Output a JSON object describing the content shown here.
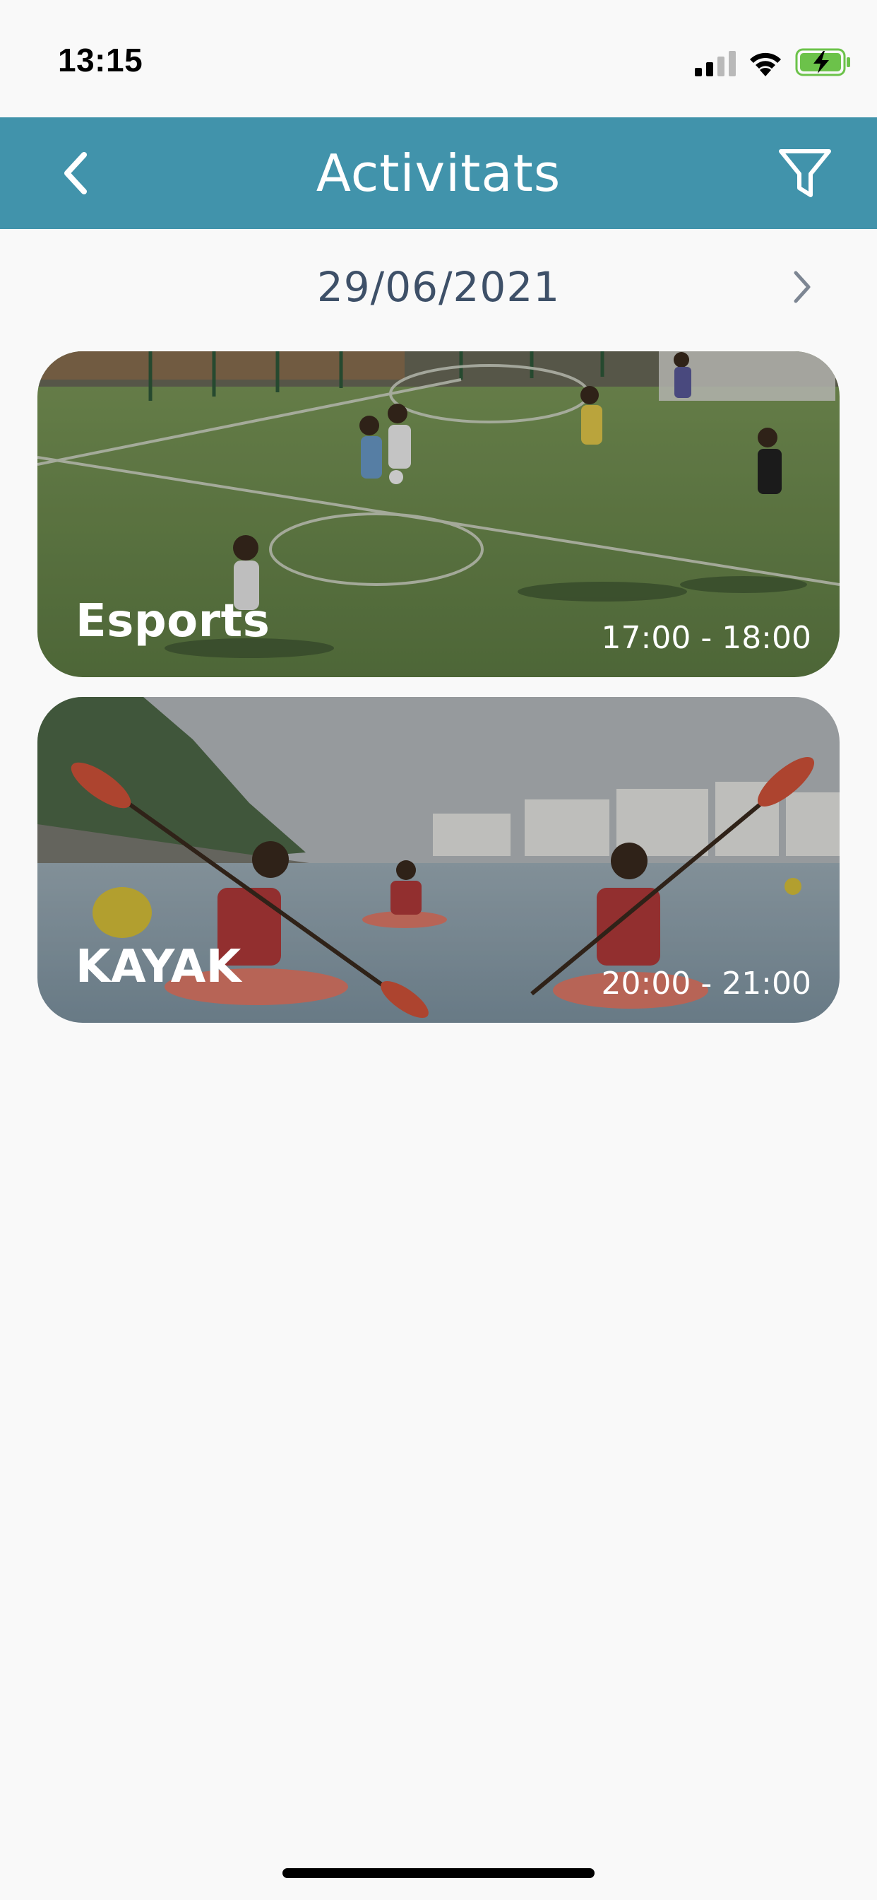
{
  "status_bar": {
    "time": "13:15",
    "icons": [
      "signal-icon",
      "wifi-icon",
      "battery-charging-icon"
    ],
    "battery_color": "#6cc24a"
  },
  "header": {
    "title": "Activitats",
    "back_icon": "chevron-left-icon",
    "filter_icon": "filter-icon",
    "background": "#4193ab"
  },
  "date_nav": {
    "date": "29/06/2021",
    "next_icon": "chevron-right-icon"
  },
  "activities": [
    {
      "name": "Esports",
      "time": "17:00 - 18:00",
      "image": "football-field-photo"
    },
    {
      "name": "KAYAK",
      "time": "20:00 - 21:00",
      "image": "kayak-sea-photo"
    }
  ]
}
